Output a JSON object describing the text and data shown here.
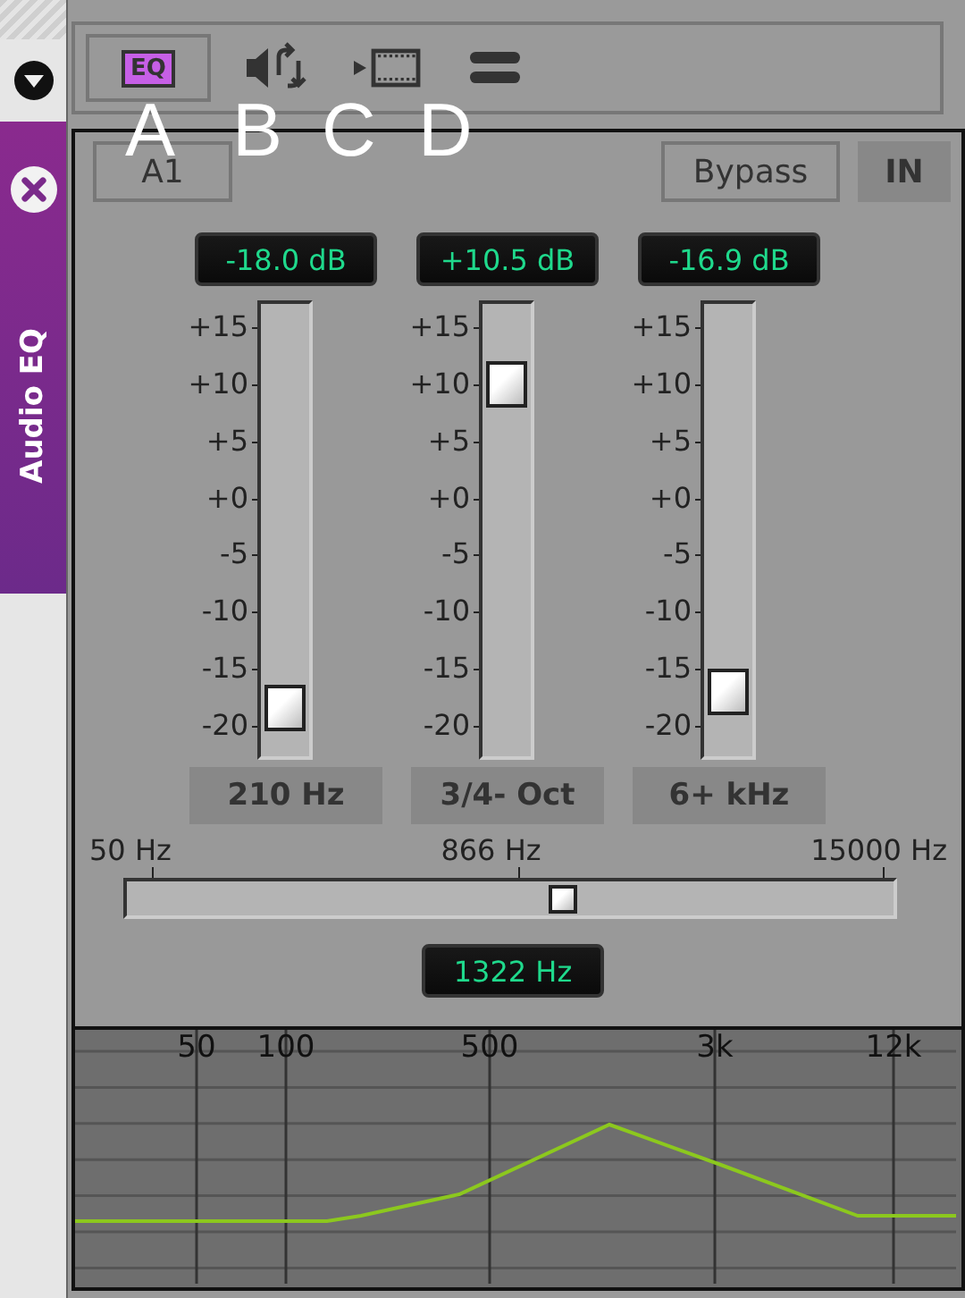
{
  "sidebar": {
    "tab_title": "Audio EQ"
  },
  "toolbar": [
    {
      "kind": "eq",
      "text": "EQ",
      "callout": "A",
      "selected": true
    },
    {
      "kind": "speaker",
      "callout": "B",
      "selected": false
    },
    {
      "kind": "film",
      "callout": "C",
      "selected": false
    },
    {
      "kind": "menu",
      "callout": "D",
      "selected": false
    }
  ],
  "preset": "A1",
  "bypass": [
    {
      "label": "Bypass",
      "selected": false
    },
    {
      "label": "IN",
      "selected": true
    }
  ],
  "bands": [
    {
      "readout": "-18.0 dB",
      "scale": [
        "+15",
        "+10",
        "+5",
        "+0",
        "-5",
        "-10",
        "-15",
        "-20"
      ],
      "level": 0.06,
      "label": "210 Hz"
    },
    {
      "readout": "+10.5 dB",
      "scale": [
        "+15",
        "+10",
        "+5",
        "+0",
        "-5",
        "-10",
        "-15",
        "-20"
      ],
      "level": 0.86,
      "label": "3/4- Oct"
    },
    {
      "readout": "-16.9 dB",
      "scale": [
        "+15",
        "+10",
        "+5",
        "+0",
        "-5",
        "-10",
        "-15",
        "-20"
      ],
      "level": 0.1,
      "label": "6+ kHz"
    }
  ],
  "frequency": {
    "scale": [
      "50 Hz",
      "866 Hz",
      "15000 Hz"
    ],
    "level": 0.575,
    "readout": "1322 Hz"
  },
  "graph": {
    "labels": [
      "50",
      "100",
      "500",
      "3k",
      "12k"
    ]
  }
}
